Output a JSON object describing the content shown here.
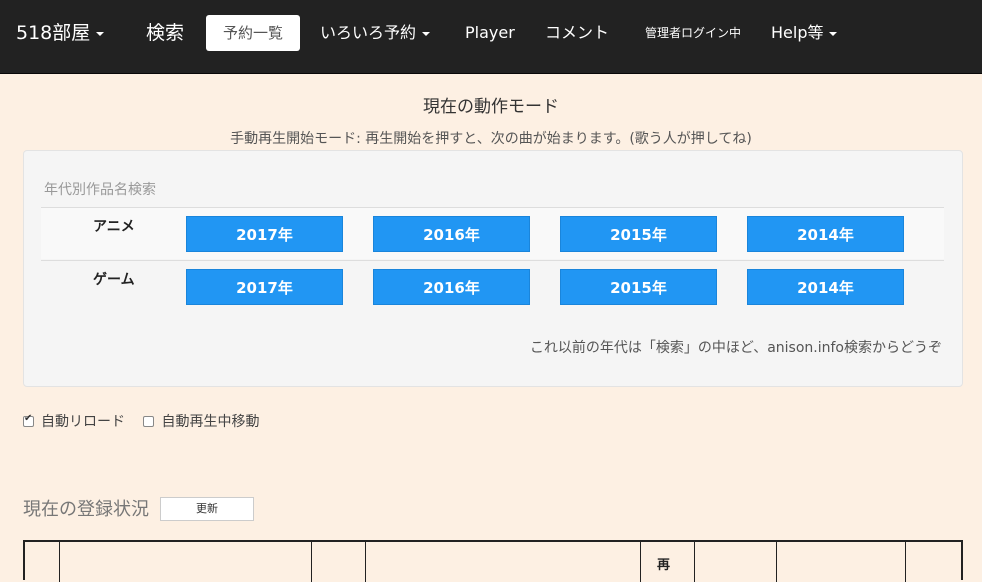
{
  "nav": {
    "brand": "518部屋",
    "search": "検索",
    "active": "予約一覧",
    "reserve": "いろいろ予約",
    "player": "Player",
    "comment": "コメント",
    "admin": "管理者ログイン中",
    "help": "Help等"
  },
  "mode": {
    "title": "現在の動作モード",
    "description": "手動再生開始モード: 再生開始を押すと、次の曲が始まります。(歌う人が押してね)"
  },
  "search_panel": {
    "heading": "年代別作品名検索",
    "rows": [
      {
        "label": "アニメ",
        "years": [
          "2017年",
          "2016年",
          "2015年",
          "2014年"
        ]
      },
      {
        "label": "ゲーム",
        "years": [
          "2017年",
          "2016年",
          "2015年",
          "2014年"
        ]
      }
    ],
    "note": "これ以前の年代は「検索」の中ほど、anison.info検索からどうぞ"
  },
  "options": {
    "auto_reload": {
      "label": "自動リロード",
      "checked": true
    },
    "auto_move": {
      "label": "自動再生中移動",
      "checked": false
    }
  },
  "registration": {
    "title": "現在の登録状況",
    "refresh_label": "更新",
    "header_fragment": "再"
  },
  "colors": {
    "navbar": "#222222",
    "background": "#fdf0e3",
    "year_button": "#2196f3"
  }
}
